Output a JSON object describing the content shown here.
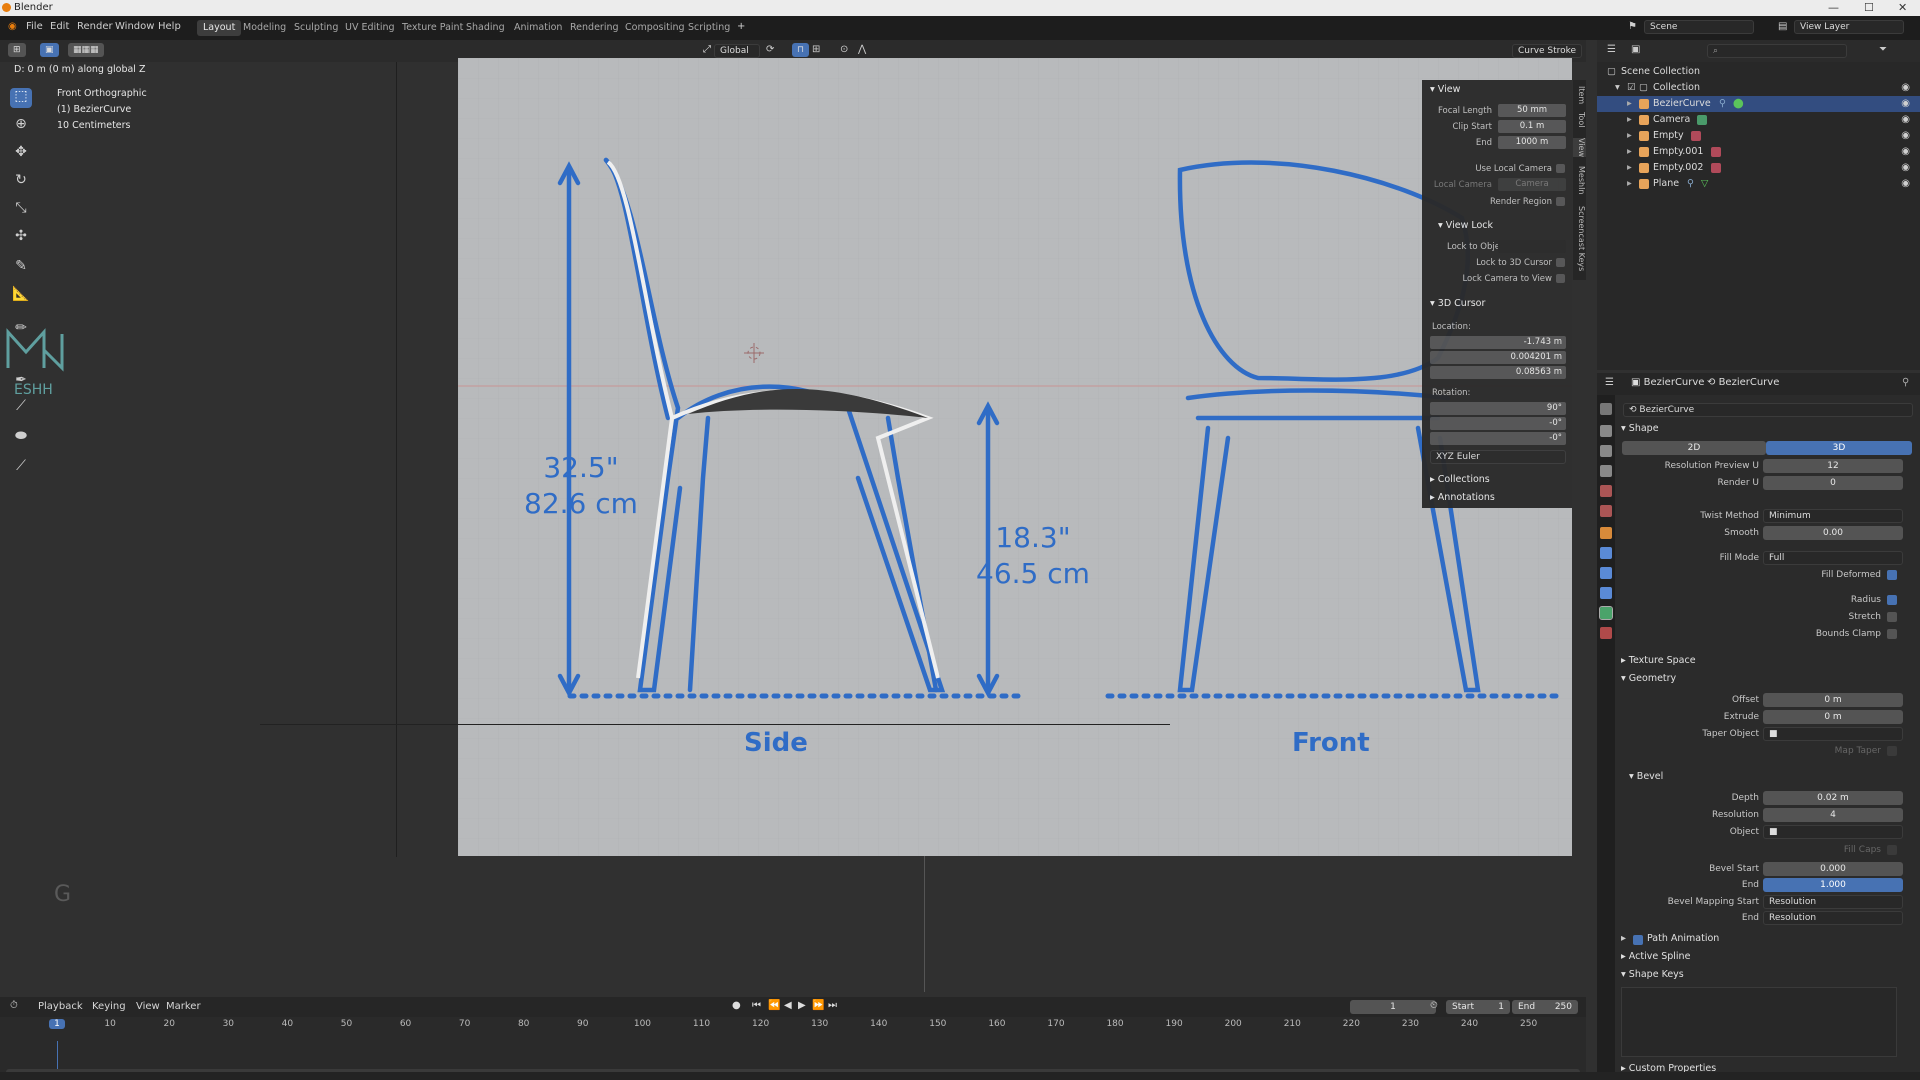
{
  "window": {
    "title": "Blender"
  },
  "menu": [
    "File",
    "Edit",
    "Render",
    "Window",
    "Help"
  ],
  "workspaces": [
    "Layout",
    "Modeling",
    "Sculpting",
    "UV Editing",
    "Texture Paint",
    "Shading",
    "Animation",
    "Rendering",
    "Compositing",
    "Scripting"
  ],
  "header": {
    "orientation": "Global",
    "mode": "Curve Stroke",
    "scene": "Scene",
    "view_layer": "View Layer"
  },
  "viewport": {
    "status": "D: 0 m (0 m) along global Z",
    "view": "Front Orthographic",
    "object": "(1) BezierCurve",
    "scale": "10 Centimeters",
    "cursor_key": "G"
  },
  "blueprint": {
    "height_in": "32.5\"",
    "height_cm": "82.6 cm",
    "seat_in": "18.3\"",
    "seat_cm": "46.5 cm",
    "side": "Side",
    "front": "Front"
  },
  "npanel": {
    "view_title": "View",
    "focal_label": "Focal Length",
    "focal": "50 mm",
    "clip_start_label": "Clip Start",
    "clip_start": "0.1 m",
    "end_label": "End",
    "clip_end": "1000 m",
    "use_local_camera": "Use Local Camera",
    "local_camera": "Local Camera",
    "camera": "Camera",
    "render_region": "Render Region",
    "view_lock": "View Lock",
    "lock_object": "Lock to Object",
    "lock_cursor": "Lock to 3D Cursor",
    "lock_camera": "Lock Camera to View",
    "cursor_title": "3D Cursor",
    "location": "Location:",
    "lx": "-1.743 m",
    "ly": "0.004201 m",
    "lz": "0.08563 m",
    "rotation": "Rotation:",
    "rx": "90°",
    "ry": "-0°",
    "rz": "-0°",
    "euler": "XYZ Euler",
    "collections": "Collections",
    "annotations": "Annotations",
    "tabs": [
      "Item",
      "Tool",
      "View",
      "MeshIn",
      "Screencast Keys"
    ]
  },
  "outliner": {
    "root": "Scene Collection",
    "collection": "Collection",
    "items": [
      "BezierCurve",
      "Camera",
      "Empty",
      "Empty.001",
      "Empty.002",
      "Plane"
    ]
  },
  "properties": {
    "object": "BezierCurve",
    "data": "BezierCurve",
    "data_name": "BezierCurve",
    "shape": "Shape",
    "d2": "2D",
    "d3": "3D",
    "res_preview_label": "Resolution Preview U",
    "res_preview": "12",
    "render_u_label": "Render U",
    "render_u": "0",
    "twist_label": "Twist Method",
    "twist": "Minimum",
    "smooth_label": "Smooth",
    "smooth": "0.00",
    "fill_label": "Fill Mode",
    "fill": "Full",
    "fill_deformed": "Fill Deformed",
    "radius": "Radius",
    "stretch": "Stretch",
    "bounds_clamp": "Bounds Clamp",
    "texture_space": "Texture Space",
    "geometry": "Geometry",
    "offset_label": "Offset",
    "offset": "0 m",
    "extrude_label": "Extrude",
    "extrude": "0 m",
    "taper_label": "Taper Object",
    "map_taper": "Map Taper",
    "bevel": "Bevel",
    "depth_label": "Depth",
    "depth": "0.02 m",
    "resolution_label": "Resolution",
    "resolution": "4",
    "object_label": "Object",
    "fill_caps": "Fill Caps",
    "bevel_start_label": "Bevel Start",
    "bevel_start": "0.000",
    "bevel_end_label": "End",
    "bevel_end": "1.000",
    "mapping_start_label": "Bevel Mapping Start",
    "mapping_start": "Resolution",
    "mapping_end_label": "End",
    "mapping_end": "Resolution",
    "path_animation": "Path Animation",
    "active_spline": "Active Spline",
    "shape_keys": "Shape Keys",
    "custom_props": "Custom Properties"
  },
  "timeline": {
    "menus": [
      "Playback",
      "Keying",
      "View",
      "Marker"
    ],
    "frame": "1",
    "start_label": "Start",
    "start": "1",
    "end_label": "End",
    "end": "250",
    "ticks": [
      "1",
      "10",
      "20",
      "30",
      "40",
      "50",
      "60",
      "70",
      "80",
      "90",
      "100",
      "110",
      "120",
      "130",
      "140",
      "150",
      "160",
      "170",
      "180",
      "190",
      "200",
      "210",
      "220",
      "230",
      "240",
      "250"
    ]
  }
}
